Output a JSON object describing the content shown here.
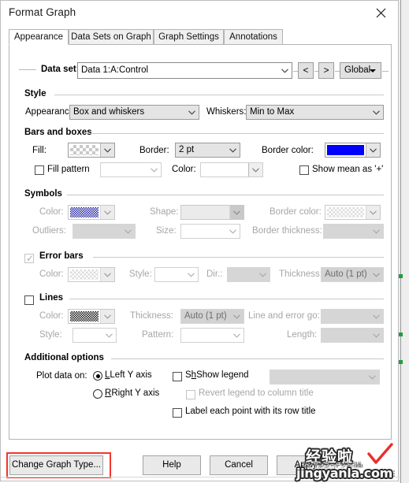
{
  "window": {
    "title": "Format Graph",
    "close_icon": "close-icon"
  },
  "tabs": [
    {
      "label": "Appearance",
      "active": true
    },
    {
      "label": "Data Sets on Graph",
      "active": false
    },
    {
      "label": "Graph Settings",
      "active": false
    },
    {
      "label": "Annotations",
      "active": false
    }
  ],
  "dataset_row": {
    "label": "Data set:",
    "value": "Data 1:A:Control",
    "prev_label": "<",
    "next_label": ">",
    "scope_label": "Global"
  },
  "style": {
    "group_title": "Style",
    "appearance_label": "Appearance:",
    "appearance_value": "Box and whiskers",
    "whiskers_label": "Whiskers:",
    "whiskers_value": "Min to Max"
  },
  "bars_and_boxes": {
    "group_title": "Bars and boxes",
    "fill_label": "Fill:",
    "fill_swatch": "transparent-checkerboard",
    "border_label": "Border:",
    "border_value": "2 pt",
    "border_color_label": "Border color:",
    "border_color_hex": "#0000FF",
    "fill_pattern_label": "Fill pattern",
    "fill_pattern_checked": false,
    "fill_pattern_value": "",
    "color_label": "Color:",
    "color_value": "",
    "show_mean_label": "Show mean as '+'",
    "show_mean_checked": false
  },
  "symbols": {
    "group_title": "Symbols",
    "color_label": "Color:",
    "color_swatch": "blue-dither",
    "shape_label": "Shape:",
    "shape_value": "",
    "border_color_label": "Border color:",
    "border_color_swatch": "transparent-checkerboard",
    "outliers_label": "Outliers:",
    "outliers_value": "",
    "size_label": "Size:",
    "size_value": "",
    "border_thickness_label": "Border thickness:",
    "border_thickness_value": ""
  },
  "error_bars": {
    "group_title": "Error bars",
    "checked": true,
    "enabled": false,
    "color_label": "Color:",
    "color_swatch": "transparent-checkerboard",
    "style_label": "Style:",
    "style_value": "",
    "dir_label": "Dir.:",
    "dir_value": "",
    "thickness_label": "Thickness:",
    "thickness_value": "Auto (1 pt)"
  },
  "lines": {
    "group_title": "Lines",
    "checked": false,
    "color_label": "Color:",
    "color_swatch": "black-dither",
    "thickness_label": "Thickness:",
    "thickness_value": "Auto (1 pt)",
    "line_error_go_label": "Line and error go:",
    "line_error_go_value": "",
    "style_label": "Style:",
    "style_value": "",
    "pattern_label": "Pattern:",
    "pattern_value": "",
    "length_label": "Length:",
    "length_value": ""
  },
  "additional_options": {
    "group_title": "Additional options",
    "plot_data_on_label": "Plot data on:",
    "left_axis_label": "Left Y axis",
    "left_axis_selected": true,
    "right_axis_label": "Right  Y axis",
    "right_axis_selected": false,
    "show_legend_label": "Show legend",
    "show_legend_checked": false,
    "legend_select_value": "",
    "revert_legend_label": "Revert legend to column title",
    "revert_legend_checked": false,
    "label_each_point_label": "Label each point with its row title",
    "label_each_point_checked": false
  },
  "footer": {
    "change_graph_type": "Change Graph Type...",
    "help": "Help",
    "cancel": "Cancel",
    "apply": "Apply"
  },
  "watermark": {
    "cn_text": "经验啦",
    "en_text": "jingyanla.com",
    "sub_text": "ジンヤンラ・ドットコム",
    "check_color": "#e8302a"
  }
}
